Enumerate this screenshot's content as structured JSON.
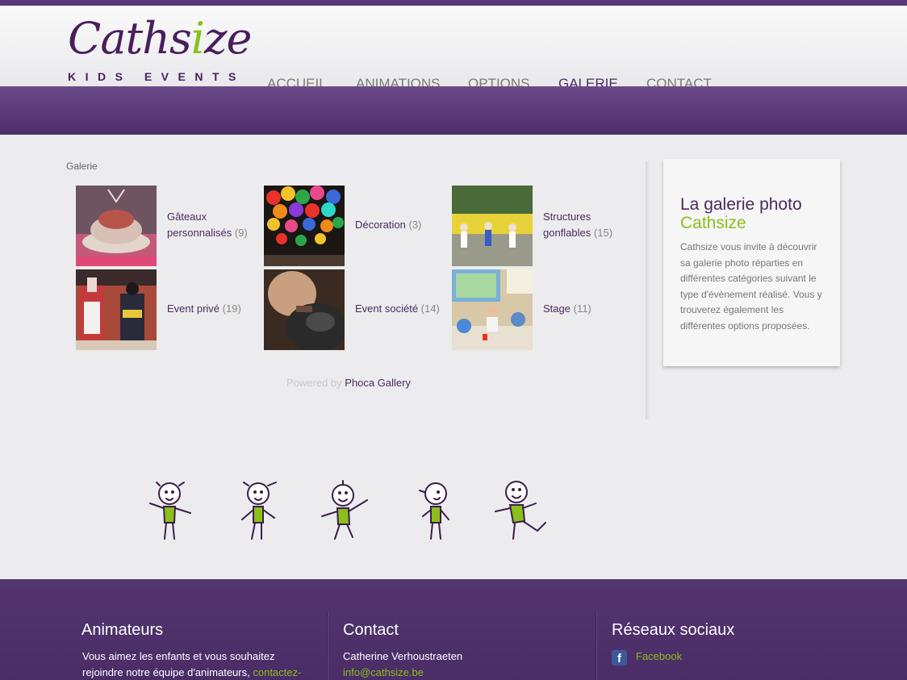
{
  "brand": {
    "name_prefix": "Cath",
    "name_s": "s",
    "name_i": "i",
    "name_suffix": "ze",
    "tagline": "KIDS EVENTS"
  },
  "nav": {
    "items": [
      {
        "label": "ACCUEIL"
      },
      {
        "label": "ANIMATIONS"
      },
      {
        "label": "OPTIONS"
      },
      {
        "label": "GALERIE"
      },
      {
        "label": "CONTACT"
      }
    ]
  },
  "breadcrumb": "Galerie",
  "gallery": {
    "categories": [
      {
        "name": "Gâteaux personnalisés",
        "count": "(9)"
      },
      {
        "name": "Décoration",
        "count": "(3)"
      },
      {
        "name": "Structures gonflables",
        "count": "(15)"
      },
      {
        "name": "Event privé",
        "count": "(19)"
      },
      {
        "name": "Event société",
        "count": "(14)"
      },
      {
        "name": "Stage",
        "count": "(11)"
      }
    ],
    "powered_prefix": "Powered by",
    "powered_link": "Phoca Gallery"
  },
  "sidebar": {
    "title_line1": "La galerie photo",
    "title_line2": "Cathsize",
    "text": "Cathsize vous invite à découvrir sa galerie photo réparties en différentes catégories suivant le type d'évènement réalisé. Vous y trouverez également les différentes options proposées."
  },
  "footer": {
    "animateurs": {
      "title": "Animateurs",
      "text": "Vous aimez les enfants et vous souhaitez rejoindre notre équipe d'animateurs,",
      "link": "contactez-"
    },
    "contact": {
      "title": "Contact",
      "name": "Catherine Verhoustraeten",
      "email": "info@cathsize.be"
    },
    "social": {
      "title": "Réseaux sociaux",
      "facebook": "Facebook"
    }
  },
  "colors": {
    "purple": "#4a2a5e",
    "green": "#8cbf1a",
    "band": "#5a3a78"
  }
}
